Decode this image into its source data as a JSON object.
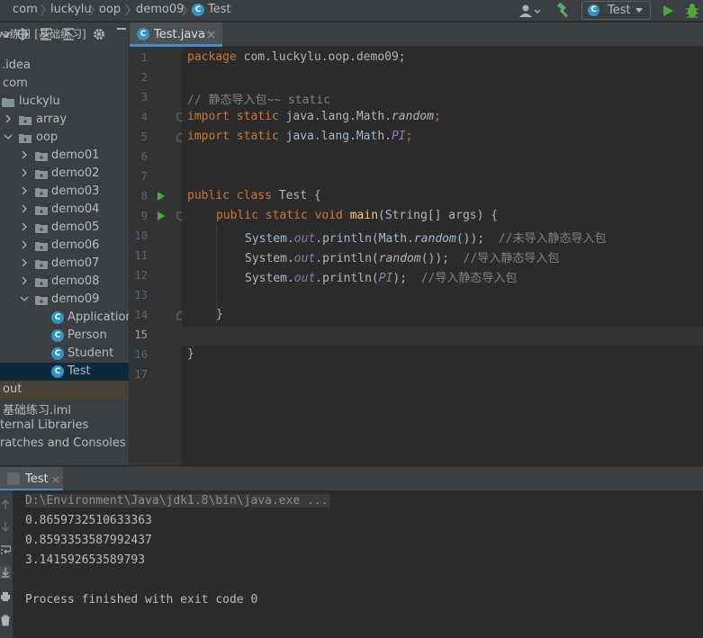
{
  "breadcrumb": [
    "com",
    "luckylu",
    "oop",
    "demo09",
    "Test"
  ],
  "toolbar": {
    "run_config": "Test",
    "colors": {
      "run": "#4fa83d",
      "build": "#59a869"
    }
  },
  "sidebar": {
    "header": "va练习 [基础练习]",
    "header_path": "source",
    "items": [
      {
        "label": ".idea",
        "kind": "folder"
      },
      {
        "label": "com",
        "kind": "package"
      },
      {
        "label": "luckylu",
        "kind": "package"
      },
      {
        "label": "array",
        "kind": "package"
      },
      {
        "label": "oop",
        "kind": "package"
      },
      {
        "label": "demo01",
        "kind": "package"
      },
      {
        "label": "demo02",
        "kind": "package"
      },
      {
        "label": "demo03",
        "kind": "package"
      },
      {
        "label": "demo04",
        "kind": "package"
      },
      {
        "label": "demo05",
        "kind": "package"
      },
      {
        "label": "demo06",
        "kind": "package"
      },
      {
        "label": "demo07",
        "kind": "package"
      },
      {
        "label": "demo08",
        "kind": "package"
      },
      {
        "label": "demo09",
        "kind": "package"
      },
      {
        "label": "Application",
        "kind": "class"
      },
      {
        "label": "Person",
        "kind": "class"
      },
      {
        "label": "Student",
        "kind": "class"
      },
      {
        "label": "Test",
        "kind": "class"
      },
      {
        "label": "out",
        "kind": "folder"
      },
      {
        "label": "基础练习.iml",
        "kind": "file"
      },
      {
        "label": "ternal Libraries",
        "kind": "library"
      },
      {
        "label": "ratches and Consoles",
        "kind": "scratch"
      }
    ]
  },
  "editor": {
    "tab_label": "Test.java",
    "line_numbers": [
      "1",
      "2",
      "3",
      "4",
      "5",
      "6",
      "7",
      "8",
      "9",
      "10",
      "11",
      "12",
      "13",
      "14",
      "15",
      "16",
      "17"
    ],
    "code": {
      "l1_kw": "package",
      "l1_rest": " com.luckylu.oop.demo09;",
      "l3": "// 静态导入包~~ static",
      "l4_kw": "import static",
      "l4_rest": " java.lang.Math.",
      "l4_it": "random",
      "l4_end": ";",
      "l5_kw": "import static",
      "l5_rest": " java.lang.Math.",
      "l5_it": "PI",
      "l5_end": ";",
      "l8_kw": "public class",
      "l8_rest": " Test {",
      "l9_kw": "public static void",
      "l9_fn": " main",
      "l9_rest": "(String[] args) {",
      "l10_a": "System.",
      "l10_out": "out",
      "l10_b": ".println(Math.",
      "l10_it": "random",
      "l10_c": "());  ",
      "l10_cm": "//未导入静态导入包",
      "l11_a": "System.",
      "l11_out": "out",
      "l11_b": ".println(",
      "l11_it": "random",
      "l11_c": "());  ",
      "l11_cm": "//导入静态导入包",
      "l12_a": "System.",
      "l12_out": "out",
      "l12_b": ".println(",
      "l12_it": "PI",
      "l12_c": ");  ",
      "l12_cm": "//导入静态导入包",
      "l14": "}",
      "l16": "}"
    }
  },
  "run": {
    "tab_label": "Test",
    "command": "D:\\Environment\\Java\\jdk1.8\\bin\\java.exe ...",
    "output": [
      "0.8659732510633363",
      "0.8593353587992437",
      "3.141592653589793"
    ],
    "finished": "Process finished with exit code 0"
  }
}
